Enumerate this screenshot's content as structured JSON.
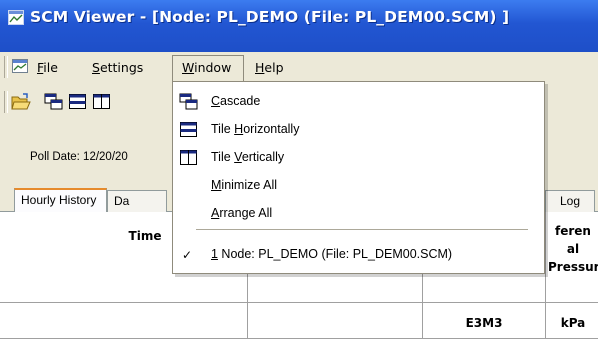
{
  "title": "SCM Viewer - [Node: PL_DEMO (File: PL_DEM00.SCM) ]",
  "menu": {
    "file": "File",
    "file_ul": "F",
    "file_rest": "ile",
    "settings": "Settings",
    "settings_ul": "S",
    "settings_rest": "ettings",
    "window": "Window",
    "window_ul": "W",
    "window_rest": "indow",
    "help": "Help",
    "help_ul": "H",
    "help_rest": "elp"
  },
  "poll": {
    "label": "Poll Date: 12/20/20"
  },
  "tabs": [
    {
      "label": "Hourly History"
    },
    {
      "label": "Da"
    },
    {
      "label": "Log"
    }
  ],
  "grid": {
    "header_time": "Time",
    "header_dp": "feren al Pressur",
    "unit_volume": "E3M3",
    "unit_pressure": "kPa"
  },
  "window_menu": {
    "items": [
      {
        "label": "Cascade",
        "ul": "C",
        "rest": "ascade",
        "icon": "cascade-icon"
      },
      {
        "label": "Tile Horizontally",
        "pre": "Tile ",
        "ul": "H",
        "rest": "orizontally",
        "icon": "tile-horizontal-icon"
      },
      {
        "label": "Tile Vertically",
        "pre": "Tile ",
        "ul": "V",
        "rest": "ertically",
        "icon": "tile-vertical-icon"
      },
      {
        "label": "Minimize All",
        "ul": "M",
        "rest": "inimize All"
      },
      {
        "label": "Arrange All",
        "ul": "A",
        "rest": "rrange All"
      }
    ],
    "open_window": {
      "check": "✓",
      "ul": "1",
      "rest": " Node: PL_DEMO (File: PL_DEM00.SCM)"
    }
  },
  "colors": {
    "title_bar": "#2256d2",
    "menu_bg": "#ece9d8",
    "active_tab_accent": "#e68b2c"
  }
}
